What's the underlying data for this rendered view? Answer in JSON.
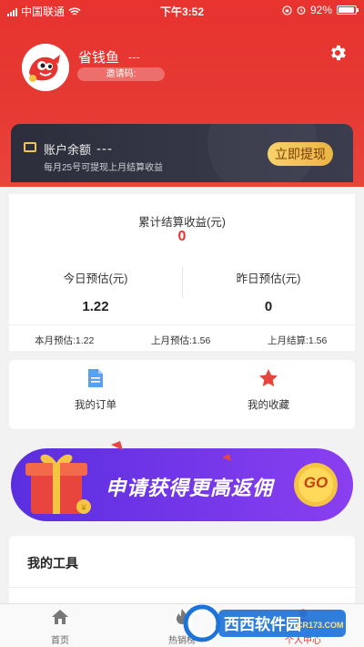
{
  "status_bar": {
    "carrier": "中国联通",
    "time": "下午3:52",
    "battery": "92%",
    "battery_level": 0.92
  },
  "profile": {
    "nickname": "省钱鱼",
    "nickname_extra": "---",
    "invite_code_label": "邀请码:"
  },
  "balance": {
    "title": "账户余额",
    "value": "---",
    "subtitle": "每月25号可提现上月结算收益",
    "withdraw_label": "立即提现"
  },
  "earnings": {
    "total_label": "累计结算收益(元)",
    "total_value": "0",
    "today_label": "今日预估(元)",
    "today_value": "1.22",
    "yesterday_label": "昨日预估(元)",
    "yesterday_value": "0",
    "this_month": "本月预估:1.22",
    "last_month_est": "上月预估:1.56",
    "last_month_settled": "上月结算:1.56"
  },
  "quick_links": [
    {
      "label": "我的订单",
      "icon": "document-icon"
    },
    {
      "label": "我的收藏",
      "icon": "star-icon"
    }
  ],
  "banner": {
    "text": "申请获得更高返佣",
    "go": "GO"
  },
  "tools": {
    "title": "我的工具"
  },
  "tabbar": [
    {
      "label": "首页",
      "icon": "home-icon"
    },
    {
      "label": "热销榜",
      "icon": "fire-icon"
    },
    {
      "label": "个人中心",
      "icon": "user-icon",
      "active": true
    }
  ],
  "watermark": {
    "brand": "西西软件园",
    "url": "CR173.COM"
  },
  "colors": {
    "brand_red": "#e8332f",
    "gold": "#f0c35b",
    "dark_card": "#2d2e3c",
    "banner_purple": "#6a2ee8"
  }
}
